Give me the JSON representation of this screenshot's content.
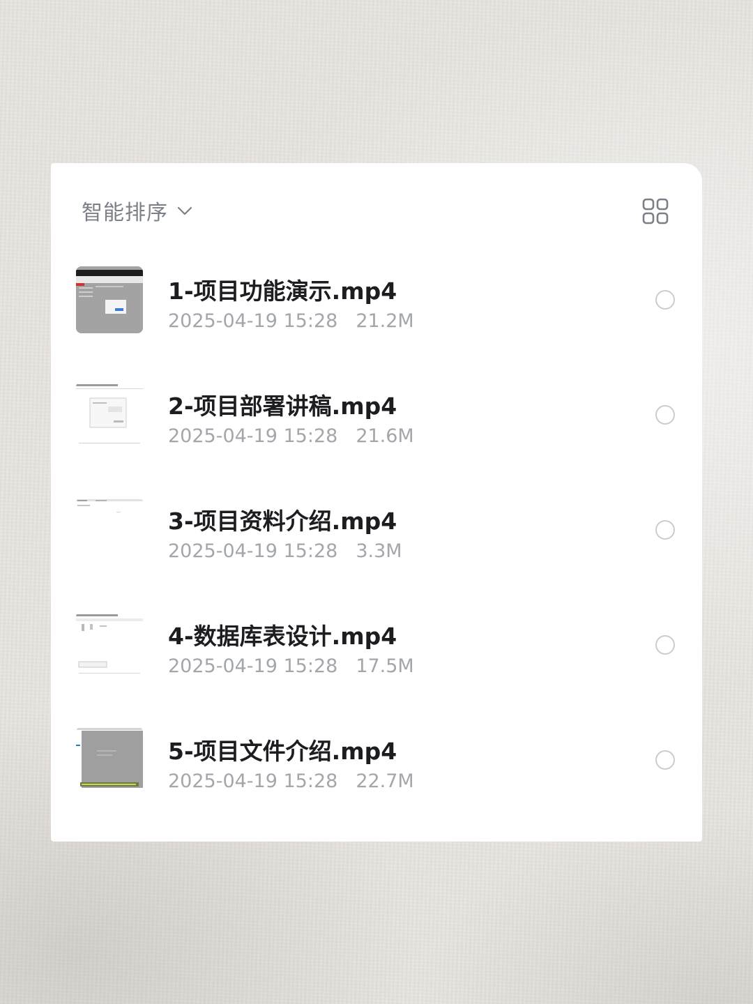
{
  "toolbar": {
    "sort_label": "智能排序",
    "sort_icon": "chevron-down-icon",
    "view_icon": "grid-view-icon"
  },
  "files": [
    {
      "name": "1-项目功能演示.mp4",
      "date": "2025-04-19 15:28",
      "size": "21.2M",
      "selected": false
    },
    {
      "name": "2-项目部署讲稿.mp4",
      "date": "2025-04-19 15:28",
      "size": "21.6M",
      "selected": false
    },
    {
      "name": "3-项目资料介绍.mp4",
      "date": "2025-04-19 15:28",
      "size": "3.3M",
      "selected": false
    },
    {
      "name": "4-数据库表设计.mp4",
      "date": "2025-04-19 15:28",
      "size": "17.5M",
      "selected": false
    },
    {
      "name": "5-项目文件介绍.mp4",
      "date": "2025-04-19 15:28",
      "size": "22.7M",
      "selected": false
    }
  ],
  "colors": {
    "title_text": "#1c1d21",
    "meta_text": "#a3a6ab",
    "sort_text": "#7b7f87",
    "radio_border": "#c9ccd1"
  }
}
